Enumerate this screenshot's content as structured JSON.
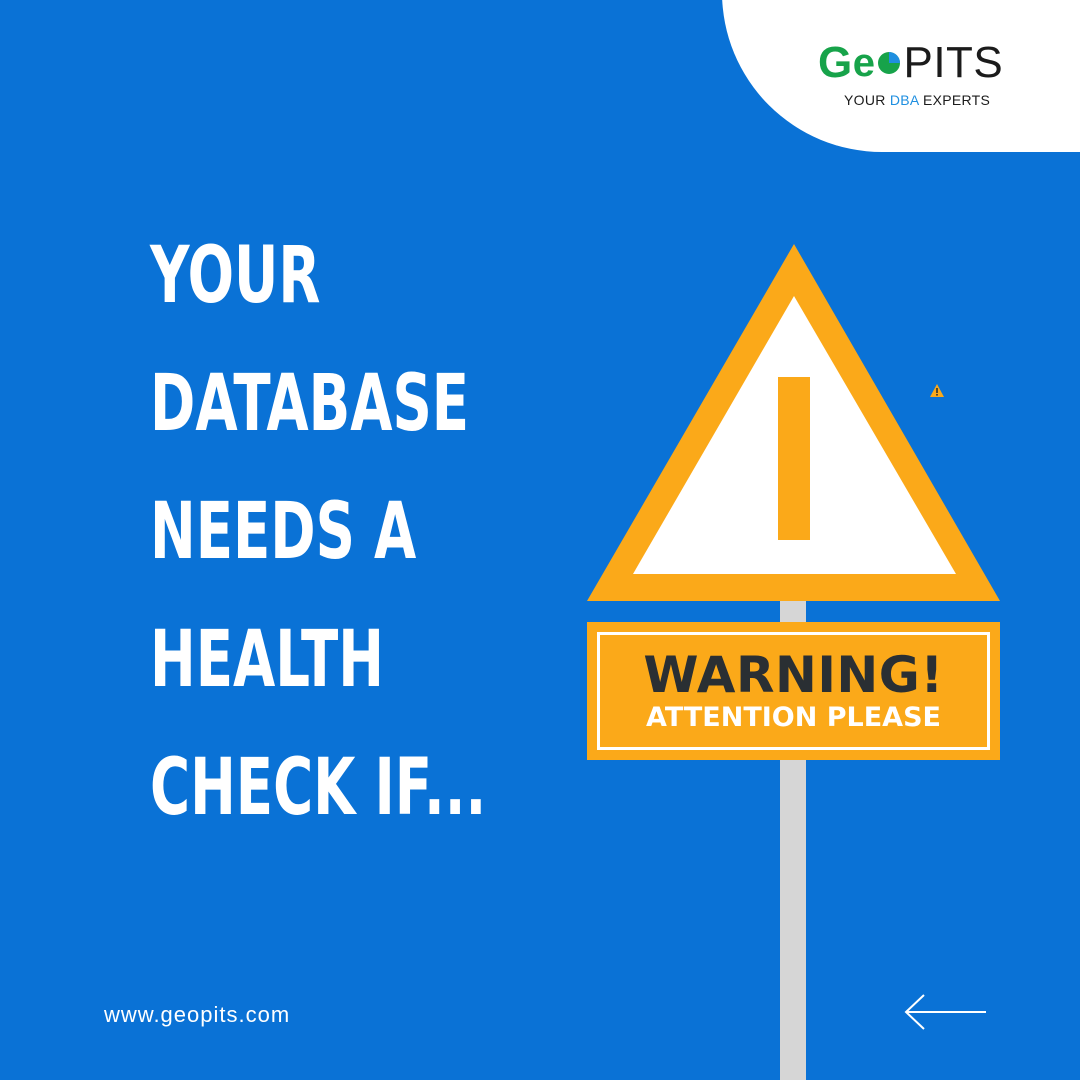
{
  "logo": {
    "word_g": "G",
    "word_e": "e",
    "word_pits": "PITS",
    "tagline_pre": "YOUR ",
    "tagline_accent": "DBA",
    "tagline_post": " EXPERTS"
  },
  "headline": {
    "lines": [
      "YOUR",
      "DATABASE",
      "NEEDS A",
      "HEALTH",
      "CHECK IF..."
    ]
  },
  "sign": {
    "title": "WARNING!",
    "subtitle": "ATTENTION PLEASE",
    "symbol": "!"
  },
  "footer": {
    "website": "www.geopits.com",
    "arrow_icon": "arrow-left-icon"
  },
  "colors": {
    "background": "#0a72d6",
    "sign_orange": "#fba919",
    "brand_green": "#17a34a",
    "brand_blue": "#1f8fe0",
    "white": "#ffffff"
  }
}
